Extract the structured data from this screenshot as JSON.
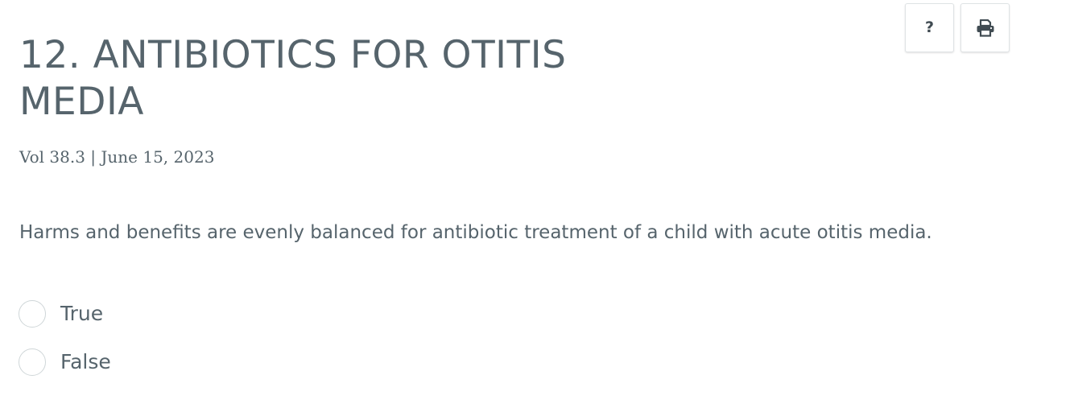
{
  "toolbar": {
    "help_label": "?",
    "help_icon": "question-mark-icon",
    "print_icon": "printer-icon"
  },
  "question": {
    "title": "12. ANTIBIOTICS FOR OTITIS MEDIA",
    "meta": "Vol 38.3 | June 15, 2023",
    "prompt": "Harms and benefits are evenly balanced for antibiotic treatment of a child with acute otitis media.",
    "options": [
      {
        "label": "True",
        "selected": false
      },
      {
        "label": "False",
        "selected": false
      }
    ]
  },
  "colors": {
    "text": "#56646c",
    "border": "#dfe3e5",
    "radio_border": "#cfd6d8"
  }
}
